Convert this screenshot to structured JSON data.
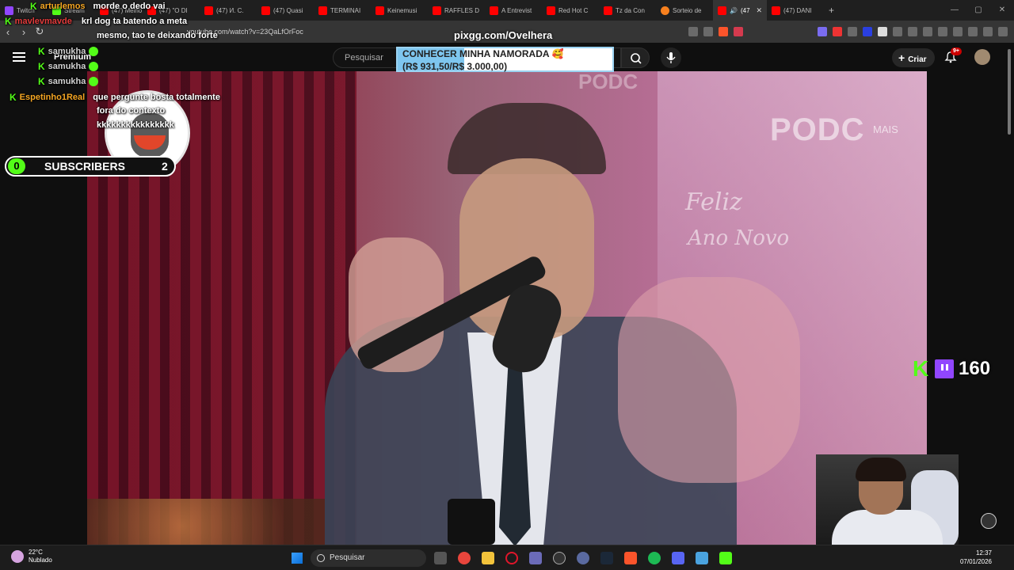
{
  "browser": {
    "tabs": [
      {
        "title": "Twitch",
        "color": "#9146ff"
      },
      {
        "title": "Stream",
        "color": "#53fc18"
      },
      {
        "title": "(47) Melho",
        "color": "#ff0000"
      },
      {
        "title": "(47) \"O DI",
        "color": "#ff0000"
      },
      {
        "title": "(47) И. С.",
        "color": "#ff0000"
      },
      {
        "title": "(47) Quasi",
        "color": "#ff0000"
      },
      {
        "title": "TERMINAI",
        "color": "#ff0000"
      },
      {
        "title": "Keinemusi",
        "color": "#ff0000"
      },
      {
        "title": "RAFFLES D",
        "color": "#ff0000"
      },
      {
        "title": "A Entrevist",
        "color": "#ff0000"
      },
      {
        "title": "Red Hot C",
        "color": "#ff0000"
      },
      {
        "title": "Tz da Con",
        "color": "#ff0000"
      },
      {
        "title": "Sorteio de",
        "color": "#f7801e"
      },
      {
        "title": "(47",
        "color": "#ff0000",
        "active": true
      },
      {
        "title": "(47) DANI",
        "color": "#ff0000"
      }
    ],
    "new_tab": "+",
    "url": "youtube.com/watch?v=23QaLfOrFoc"
  },
  "youtube": {
    "premium_label": "Premium",
    "search_placeholder": "Pesquisar",
    "create_label": "Criar",
    "notifications_badge": "9+"
  },
  "overlay": {
    "pixgg_label": "pixgg.com/Ovelhera",
    "donation": {
      "line1": "CONHECER MINHA NAMORADA 🥰",
      "line2": "(R$ 931,50/R$ 3.000,00)",
      "amount_current": 931.5,
      "amount_goal": 3000
    },
    "subs_goal": {
      "current": "0",
      "label": "SUBSCRIBERS",
      "goal": "2"
    },
    "viewer_count": "160",
    "brand_text": "PODC",
    "brand_suffix": "MAIS",
    "banner_line1": "Feliz",
    "banner_line2": "Ano Novo"
  },
  "chat": [
    {
      "user": "arturlemos",
      "message": "morde o dedo vai",
      "user_color": "#f5a623"
    },
    {
      "user": "mavlevmavde",
      "message": "krl dog ta batendo a meta",
      "user_color": "#e23b3b"
    },
    {
      "user": "",
      "message": "mesmo, tao te deixando forte",
      "user_color": "#ffffff"
    },
    {
      "user": "samukha",
      "message": "",
      "user_color": "#d0d0d0"
    },
    {
      "user": "samukha",
      "message": "",
      "user_color": "#d0d0d0"
    },
    {
      "user": "samukha",
      "message": "",
      "user_color": "#d0d0d0"
    },
    {
      "user": "Espetinho1Real",
      "message": "que pergunte bosta totalmente",
      "user_color": "#f5a623"
    },
    {
      "user": "",
      "message": "fora do contexto",
      "user_color": "#ffffff"
    },
    {
      "user": "",
      "message": "kkkkkkkkkkkkkkkk",
      "user_color": "#ffffff"
    }
  ],
  "taskbar": {
    "temperature": "22°C",
    "weather": "Nublado",
    "search_label": "Pesquisar",
    "time": "12:37",
    "date": "07/01/2026"
  }
}
